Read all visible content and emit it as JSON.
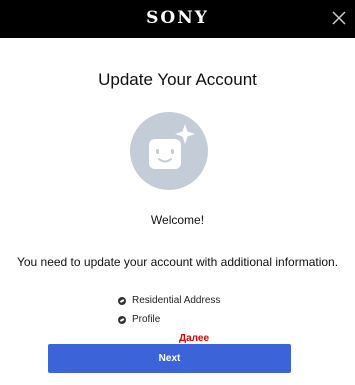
{
  "header": {
    "brand": "SONY",
    "close_icon": "close-icon",
    "background_color": "#000000"
  },
  "main": {
    "title": "Update Your Account",
    "avatar_icon": "smiley-sparkle-avatar-icon",
    "welcome": "Welcome!",
    "message": "You need to update your account with additional information.",
    "items": [
      {
        "label": "Residential Address",
        "icon": "check-bullet-icon"
      },
      {
        "label": "Profile",
        "icon": "check-bullet-icon"
      }
    ]
  },
  "annotation": {
    "text": "Далее",
    "color": "#e00000"
  },
  "actions": {
    "next_label": "Next",
    "button_color": "#3d63d9"
  }
}
